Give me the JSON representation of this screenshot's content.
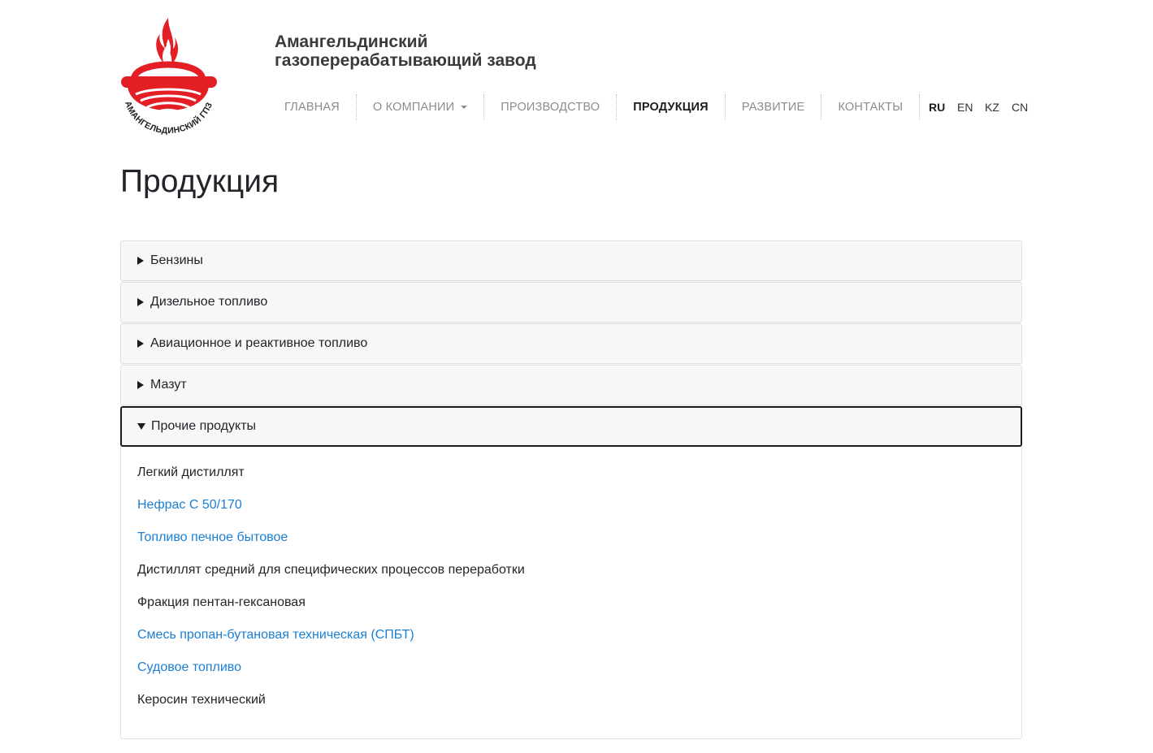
{
  "header": {
    "brand_line1": "Амангельдинский",
    "brand_line2": "газоперерабатывающий завод",
    "logo_text": "АМАНГЕЛЬДИНСКИЙ ГПЗ",
    "logo_color": "#e31e24"
  },
  "nav": {
    "items": [
      {
        "label": "ГЛАВНАЯ",
        "active": false
      },
      {
        "label": "О КОМПАНИИ",
        "active": false,
        "dropdown": true
      },
      {
        "label": "ПРОИЗВОДСТВО",
        "active": false
      },
      {
        "label": "ПРОДУКЦИЯ",
        "active": true
      },
      {
        "label": "РАЗВИТИЕ",
        "active": false
      },
      {
        "label": "КОНТАКТЫ",
        "active": false
      }
    ]
  },
  "languages": [
    {
      "label": "RU",
      "active": true
    },
    {
      "label": "EN",
      "active": false
    },
    {
      "label": "KZ",
      "active": false
    },
    {
      "label": "CN",
      "active": false
    }
  ],
  "page": {
    "title": "Продукция"
  },
  "accordion": {
    "sections": [
      {
        "label": "Бензины",
        "open": false
      },
      {
        "label": "Дизельное топливо",
        "open": false
      },
      {
        "label": "Авиационное и реактивное топливо",
        "open": false
      },
      {
        "label": "Мазут",
        "open": false
      },
      {
        "label": "Прочие продукты",
        "open": true
      }
    ],
    "open_products": [
      {
        "label": "Легкий дистиллят",
        "link": false
      },
      {
        "label": "Нефрас С 50/170",
        "link": true
      },
      {
        "label": "Топливо печное бытовое",
        "link": true
      },
      {
        "label": "Дистиллят средний для специфических процессов переработки",
        "link": false
      },
      {
        "label": "Фракция пентан-гексановая",
        "link": false
      },
      {
        "label": "Смесь пропан-бутановая техническая (СПБТ)",
        "link": true
      },
      {
        "label": "Судовое топливо",
        "link": true
      },
      {
        "label": "Керосин технический",
        "link": false
      }
    ]
  },
  "colors": {
    "link": "#1a7fd4",
    "accent": "#e31e24"
  }
}
